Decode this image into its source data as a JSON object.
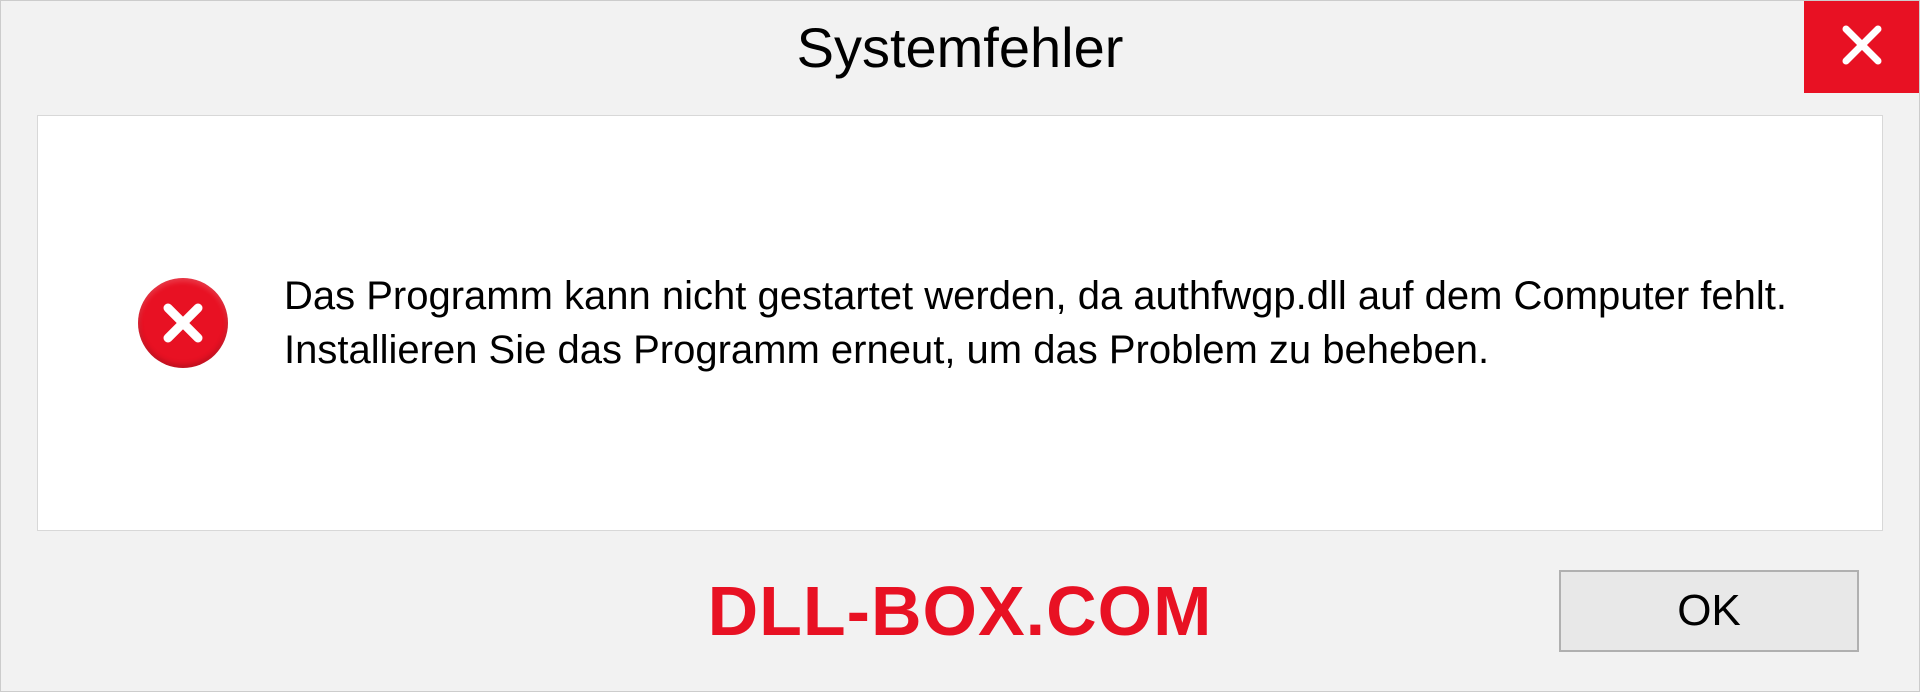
{
  "dialog": {
    "title": "Systemfehler",
    "message": "Das Programm kann nicht gestartet werden, da authfwgp.dll auf dem Computer fehlt. Installieren Sie das Programm erneut, um das Problem zu beheben.",
    "ok_label": "OK"
  },
  "watermark": "DLL-BOX.COM",
  "colors": {
    "error_red": "#e81123",
    "panel_bg": "#f2f2f2"
  }
}
